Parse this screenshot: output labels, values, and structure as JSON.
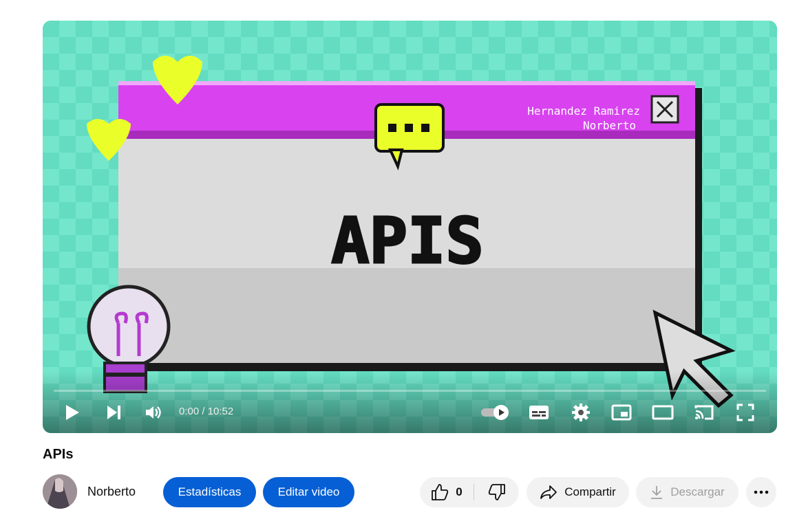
{
  "video": {
    "thumbnail": {
      "heading": "APIS",
      "author_line1": "Hernandez Ramirez",
      "author_line2": "Norberto"
    },
    "time_display": "0:00 / 10:52",
    "progress_fraction": 0,
    "title": "APIs"
  },
  "channel": {
    "name": "Norberto"
  },
  "actions": {
    "stats_label": "Estadísticas",
    "edit_label": "Editar video",
    "like_count": "0",
    "share_label": "Compartir",
    "download_label": "Descargar"
  },
  "icons": [
    "play-icon",
    "next-icon",
    "volume-icon",
    "autoplay-toggle-icon",
    "subtitles-icon",
    "settings-icon",
    "miniplayer-icon",
    "theater-icon",
    "cast-icon",
    "fullscreen-icon",
    "like-icon",
    "dislike-icon",
    "share-icon",
    "download-icon",
    "more-icon"
  ],
  "colors": {
    "thumbnail_bg": "#6fe3c9",
    "window_titlebar": "#d842ef",
    "hearts": "#eaff2a",
    "primary_button": "#065fd4"
  }
}
